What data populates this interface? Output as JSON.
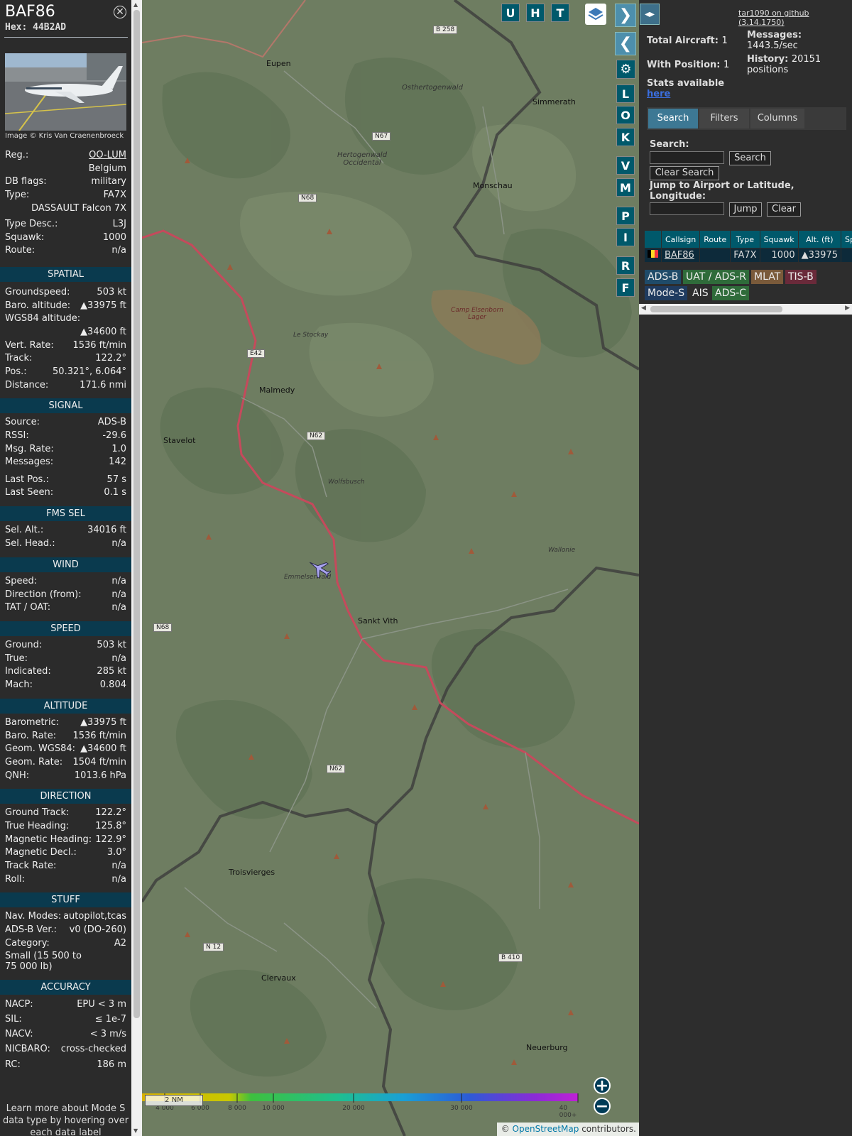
{
  "aircraft": {
    "callsign": "BAF86",
    "hex": "Hex: 44B2AD",
    "image_credit": "Image © Kris Van Craenenbroeck",
    "details": [
      {
        "k": "Reg.:",
        "v": "OO-LUM"
      },
      {
        "k": "",
        "v": "Belgium"
      },
      {
        "k": "DB flags:",
        "v": "military"
      },
      {
        "k": "Type:",
        "v": "FA7X"
      },
      {
        "k": "",
        "v": "DASSAULT Falcon 7X"
      },
      {
        "k": "Type Desc.:",
        "v": "L3J"
      },
      {
        "k": "Squawk:",
        "v": "1000"
      },
      {
        "k": "Route:",
        "v": "n/a"
      }
    ]
  },
  "sections": {
    "spatial": {
      "title": "SPATIAL",
      "rows": [
        {
          "k": "Groundspeed:",
          "v": "503 kt"
        },
        {
          "k": "Baro. altitude:",
          "v": "▲33975 ft"
        },
        {
          "k": "WGS84 altitude:",
          "v": ""
        },
        {
          "k": "",
          "v": "▲34600 ft"
        },
        {
          "k": "Vert. Rate:",
          "v": "1536 ft/min"
        },
        {
          "k": "Track:",
          "v": "122.2°"
        },
        {
          "k": "Pos.:",
          "v": "50.321°, 6.064°"
        },
        {
          "k": "Distance:",
          "v": "171.6 nmi"
        }
      ]
    },
    "signal": {
      "title": "SIGNAL",
      "rows": [
        {
          "k": "Source:",
          "v": "ADS-B"
        },
        {
          "k": "RSSI:",
          "v": "-29.6"
        },
        {
          "k": "Msg. Rate:",
          "v": "1.0"
        },
        {
          "k": "Messages:",
          "v": "142"
        },
        {
          "k": "Last Pos.:",
          "v": "57 s"
        },
        {
          "k": "Last Seen:",
          "v": "0.1 s"
        }
      ]
    },
    "fms": {
      "title": "FMS SEL",
      "rows": [
        {
          "k": "Sel. Alt.:",
          "v": "34016 ft"
        },
        {
          "k": "Sel. Head.:",
          "v": "n/a"
        }
      ]
    },
    "wind": {
      "title": "WIND",
      "rows": [
        {
          "k": "Speed:",
          "v": "n/a"
        },
        {
          "k": "Direction (from):",
          "v": "n/a"
        },
        {
          "k": "TAT / OAT:",
          "v": "n/a"
        }
      ]
    },
    "speed": {
      "title": "SPEED",
      "rows": [
        {
          "k": "Ground:",
          "v": "503 kt"
        },
        {
          "k": "True:",
          "v": "n/a"
        },
        {
          "k": "Indicated:",
          "v": "285 kt"
        },
        {
          "k": "Mach:",
          "v": "0.804"
        }
      ]
    },
    "altitude": {
      "title": "ALTITUDE",
      "rows": [
        {
          "k": "Barometric:",
          "v": "▲33975 ft"
        },
        {
          "k": "Baro. Rate:",
          "v": "1536 ft/min"
        },
        {
          "k": "Geom. WGS84:",
          "v": "▲34600 ft"
        },
        {
          "k": "Geom. Rate:",
          "v": "1504 ft/min"
        },
        {
          "k": "QNH:",
          "v": "1013.6 hPa"
        }
      ]
    },
    "direction": {
      "title": "DIRECTION",
      "rows": [
        {
          "k": "Ground Track:",
          "v": "122.2°"
        },
        {
          "k": "True Heading:",
          "v": "125.8°"
        },
        {
          "k": "Magnetic Heading:",
          "v": "122.9°"
        },
        {
          "k": "Magnetic Decl.:",
          "v": "3.0°"
        },
        {
          "k": "Track Rate:",
          "v": "n/a"
        },
        {
          "k": "Roll:",
          "v": "n/a"
        }
      ]
    },
    "stuff": {
      "title": "STUFF",
      "rows": [
        {
          "k": "Nav. Modes:",
          "v": "autopilot,tcas"
        },
        {
          "k": "ADS-B Ver.:",
          "v": "v0 (DO-260)"
        },
        {
          "k": "Category:",
          "v": "A2"
        },
        {
          "k": "Small (15 500 to",
          "v": ""
        },
        {
          "k": "75 000 lb)",
          "v": ""
        }
      ]
    },
    "accuracy": {
      "title": "ACCURACY",
      "rows": [
        {
          "k": "NACP:",
          "v": "EPU < 3 m"
        },
        {
          "k": "SIL:",
          "v": "≤ 1e-7"
        },
        {
          "k": "NACV:",
          "v": "< 3 m/s"
        },
        {
          "k": "NICBARO:",
          "v": "cross-checked"
        },
        {
          "k": "RC:",
          "v": "186 m"
        }
      ]
    }
  },
  "learn_more": [
    "Learn more about Mode S",
    "data type by hovering over",
    "each data label"
  ],
  "map": {
    "top_buttons": [
      "U",
      "H",
      "T"
    ],
    "side_buttons": [
      "L",
      "O",
      "K",
      "V",
      "M",
      "P",
      "I",
      "R",
      "F"
    ],
    "place_labels": [
      "Eupen",
      "Osthertogenwald",
      "Simmerath",
      "Hertogenwald Occidental",
      "Monschau",
      "Camp Elsenborn Lager",
      "Le Stockay",
      "Malmedy",
      "Stavelot",
      "Wolfsbusch",
      "Emmelserwald",
      "Sankt Vith",
      "Troisvierges",
      "Clervaux",
      "Neuerburg",
      "Wallonie"
    ],
    "road_labels": [
      "B 258",
      "N67",
      "N68",
      "E42",
      "N62",
      "N62",
      "N68",
      "N 12",
      "B 410"
    ],
    "scale": "2 NM",
    "altitude_scale": [
      "4 000",
      "6 000",
      "8 000",
      "10 000",
      "20 000",
      "30 000",
      "40 000+"
    ],
    "attribution_prefix": "© ",
    "attribution_link": "OpenStreetMap",
    "attribution_suffix": " contributors."
  },
  "stats": {
    "github": "tar1090 on github (3.14.1750)",
    "total_label": "Total Aircraft:",
    "total_value": "1",
    "position_label": "With Position:",
    "position_value": "1",
    "messages_label": "Messages:",
    "messages_value": "1443.5/sec",
    "history_label": "History:",
    "history_value": "20151 positions",
    "stats_label": "Stats available",
    "stats_link": "here"
  },
  "tabs": [
    "Search",
    "Filters",
    "Columns"
  ],
  "search": {
    "label": "Search:",
    "button": "Search",
    "clear_button": "Clear Search",
    "jump_label": "Jump to Airport or Latitude, Longitude:",
    "jump_button": "Jump",
    "clear_jump_button": "Clear"
  },
  "table": {
    "headers": [
      "",
      "Callsign",
      "Route",
      "Type",
      "Squawk",
      "Alt. (ft)",
      "Spd"
    ],
    "rows": [
      {
        "callsign": "BAF86",
        "route": "",
        "type": "FA7X",
        "squawk": "1000",
        "alt": "▲33975",
        "spd": ""
      }
    ]
  },
  "legend": [
    {
      "label": "ADS-B",
      "color": "#1f4b69"
    },
    {
      "label": "UAT / ADS-R",
      "color": "#2f6b3a"
    },
    {
      "label": "MLAT",
      "color": "#7a5a3a"
    },
    {
      "label": "TIS-B",
      "color": "#6a2a3a"
    },
    {
      "label": "Mode-S",
      "color": "#1f3b5f"
    },
    {
      "label": "AIS",
      "color": "#2d2d2d"
    },
    {
      "label": "ADS-C",
      "color": "#2f6b3a"
    }
  ]
}
